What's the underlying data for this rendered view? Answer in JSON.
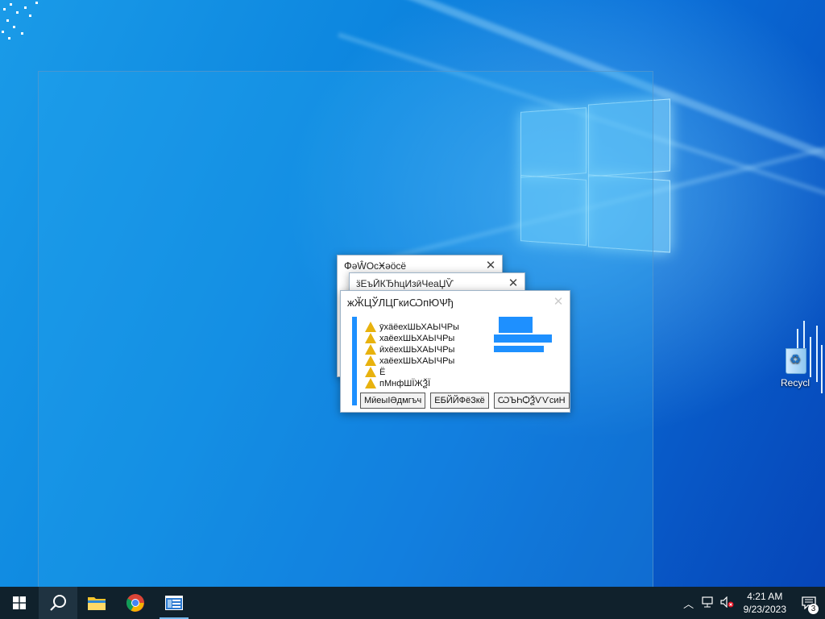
{
  "desktop": {
    "recycle_bin_label": "Recycl",
    "dialogs": [
      {
        "title": "ՓәŴОсӾәӧсё",
        "close": "✕"
      },
      {
        "title": "ӟЕъӢКЂһцИзӣЧеаЏѶ",
        "close": "✕"
      },
      {
        "title": "жӁЦЎЛЦГкиѠпЮѰђ",
        "close": "✕",
        "rows": [
          "ӯхӓёехШЬХАЬӀЧРы",
          "хаёехШЬХАЬӀЧРы",
          "ӣхёехШЬХАЬӀЧРы",
          "хаёехШЬХАЬӀЧРы",
          "Ё",
          "пМнфШЇЖѮЇ"
        ],
        "buttons": [
          "МӣеыӀӘдмгъч",
          "ЕБЙЙФёЗкё",
          "ѠЪҺѺѮѴѴсиН"
        ]
      }
    ]
  },
  "taskbar": {
    "start_icon": "windows-start-icon",
    "search_icon": "search-icon",
    "apps": [
      "file-explorer-icon",
      "chrome-icon",
      "app-window-icon"
    ],
    "tray_icons": [
      "chevron-up-icon",
      "network-icon",
      "volume-muted-icon"
    ],
    "time": "4:21 AM",
    "date": "9/23/2023",
    "notification_count": "3"
  }
}
